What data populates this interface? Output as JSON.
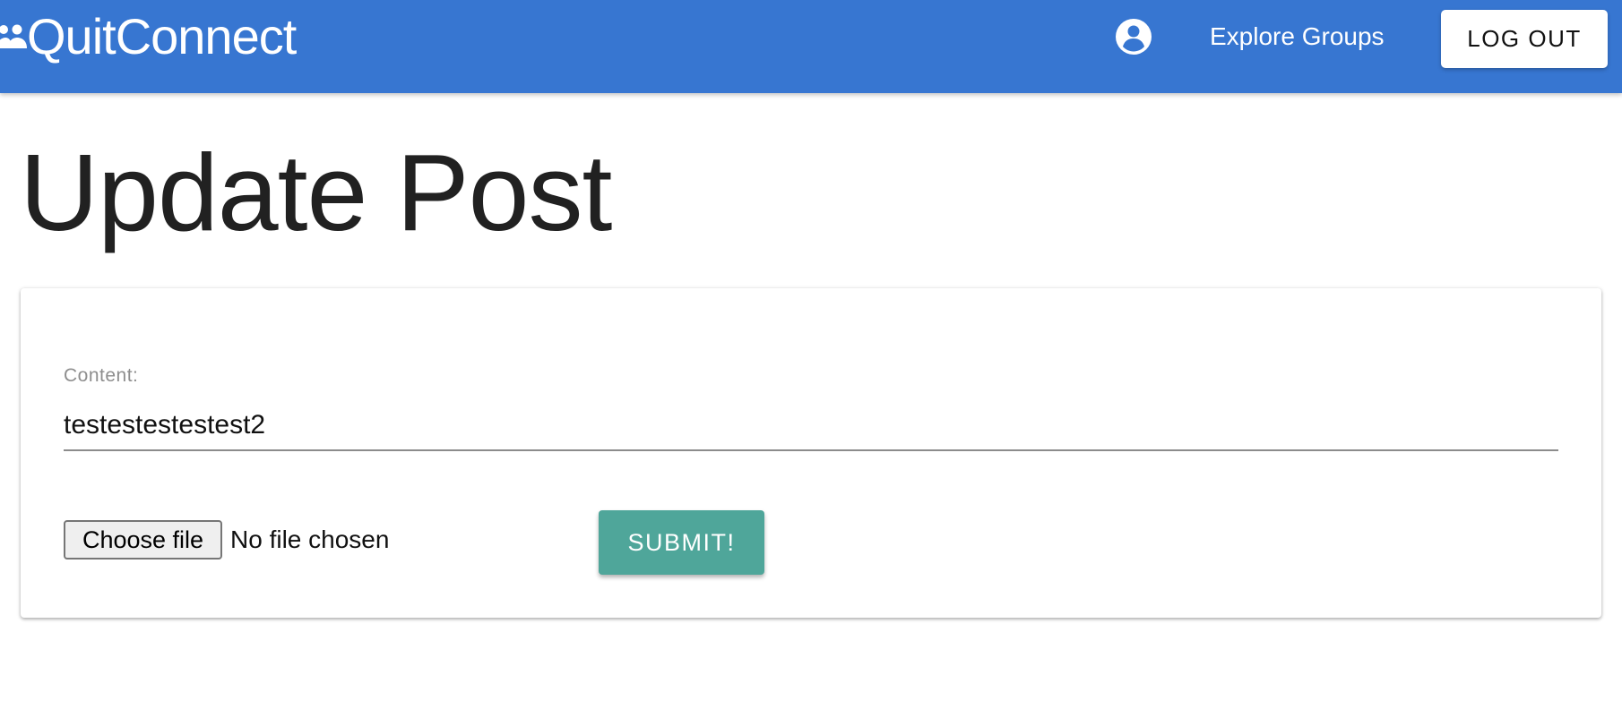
{
  "header": {
    "brand_name": "QuitConnect",
    "brand_icon": "group-icon",
    "account_icon": "account-circle-icon",
    "nav_link": "Explore Groups",
    "logout_label": "LOG OUT",
    "bar_color": "#3776d1"
  },
  "page": {
    "title": "Update Post"
  },
  "form": {
    "content_label": "Content:",
    "content_value": "testestestestest2",
    "choose_file_label": "Choose file",
    "file_status": "No file chosen",
    "submit_label": "SUBMIT!",
    "submit_color": "#4fa69a"
  }
}
